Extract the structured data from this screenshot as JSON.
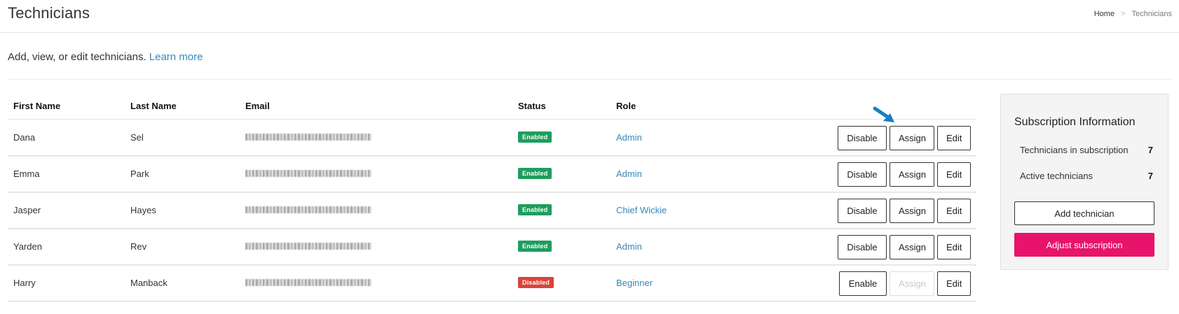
{
  "header": {
    "title": "Technicians",
    "breadcrumb": {
      "home": "Home",
      "separator": ">",
      "current": "Technicians"
    }
  },
  "intro": {
    "text": "Add, view, or edit technicians.",
    "link": "Learn more"
  },
  "table": {
    "columns": {
      "first_name": "First Name",
      "last_name": "Last Name",
      "email": "Email",
      "status": "Status",
      "role": "Role"
    },
    "rows": [
      {
        "first": "Dana",
        "last": "Sel",
        "email_blurred": true,
        "status": "Enabled",
        "role": "Admin",
        "toggle_label": "Disable",
        "assign_label": "Assign",
        "edit_label": "Edit",
        "assign_disabled": false
      },
      {
        "first": "Emma",
        "last": "Park",
        "email_blurred": true,
        "status": "Enabled",
        "role": "Admin",
        "toggle_label": "Disable",
        "assign_label": "Assign",
        "edit_label": "Edit",
        "assign_disabled": false
      },
      {
        "first": "Jasper",
        "last": "Hayes",
        "email_blurred": true,
        "status": "Enabled",
        "role": "Chief Wickie",
        "toggle_label": "Disable",
        "assign_label": "Assign",
        "edit_label": "Edit",
        "assign_disabled": false
      },
      {
        "first": "Yarden",
        "last": "Rev",
        "email_blurred": true,
        "status": "Enabled",
        "role": "Admin",
        "toggle_label": "Disable",
        "assign_label": "Assign",
        "edit_label": "Edit",
        "assign_disabled": false
      },
      {
        "first": "Harry",
        "last": "Manback",
        "email_blurred": true,
        "status": "Disabled",
        "role": "Beginner",
        "toggle_label": "Enable",
        "assign_label": "Assign",
        "edit_label": "Edit",
        "assign_disabled": true
      }
    ]
  },
  "subscription": {
    "title": "Subscription Information",
    "technicians_in_subscription_label": "Technicians in subscription",
    "technicians_in_subscription": "7",
    "active_technicians_label": "Active technicians",
    "active_technicians": "7",
    "add_button": "Add technician",
    "adjust_button": "Adjust subscription"
  },
  "colors": {
    "link": "#3a87b8",
    "enabled_badge": "#1e9e5e",
    "disabled_badge": "#d9443a",
    "primary_button": "#e8136a",
    "annotation_arrow": "#1a7fc0"
  },
  "annotation": {
    "icon": "pointer-arrow-icon"
  }
}
